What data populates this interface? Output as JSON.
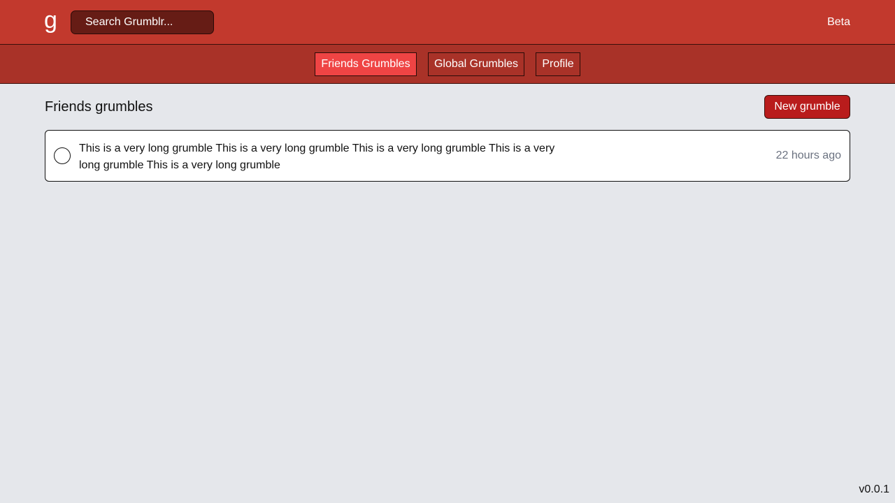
{
  "header": {
    "logo": "g",
    "search_placeholder": "Search Grumblr...",
    "badge": "Beta"
  },
  "nav": {
    "tabs": [
      {
        "label": "Friends Grumbles",
        "active": true
      },
      {
        "label": "Global Grumbles",
        "active": false
      },
      {
        "label": "Profile",
        "active": false
      }
    ]
  },
  "main": {
    "title": "Friends grumbles",
    "new_button_label": "New grumble",
    "grumbles": [
      {
        "text": "This is a very long grumble This is a very long grumble This is a very long grumble This is a very long grumble This is a very long grumble",
        "time": "22 hours ago"
      }
    ]
  },
  "footer": {
    "version": "v0.0.1"
  },
  "colors": {
    "header_bg": "#c2392d",
    "nav_bg": "#a93228",
    "active_tab": "#ef4444",
    "button_bg": "#b91c1c",
    "page_bg": "#e5e7eb"
  }
}
